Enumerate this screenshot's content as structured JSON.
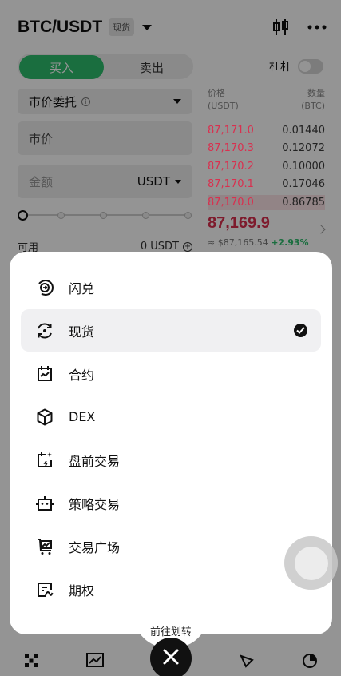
{
  "header": {
    "pair": "BTC/USDT",
    "badge": "现货"
  },
  "trade_tabs": {
    "buy": "买入",
    "sell": "卖出"
  },
  "leverage_label": "杠杆",
  "order_type": {
    "label": "市价委托",
    "info": "i"
  },
  "price_input": {
    "placeholder": "市价"
  },
  "amount_input": {
    "placeholder": "金额",
    "unit": "USDT"
  },
  "slider": {
    "value_percent": 0
  },
  "available": {
    "label": "可用",
    "value": "0 USDT"
  },
  "orderbook": {
    "price_header": "价格",
    "price_unit": "(USDT)",
    "qty_header": "数量",
    "qty_unit": "(BTC)",
    "asks": [
      {
        "price": "87,171.0",
        "qty": "0.01440",
        "depth": 0.0
      },
      {
        "price": "87,170.3",
        "qty": "0.12072",
        "depth": 0.0
      },
      {
        "price": "87,170.2",
        "qty": "0.10000",
        "depth": 0.0
      },
      {
        "price": "87,170.1",
        "qty": "0.17046",
        "depth": 0.0
      },
      {
        "price": "87,170.0",
        "qty": "0.86785",
        "depth": 1.0
      }
    ],
    "last_price": "87,169.9",
    "last_usd": "≈ $87,165.54",
    "change": "+2.93%"
  },
  "menu": {
    "items": [
      {
        "label": "闪兑",
        "icon": "swap-circle-icon",
        "selected": false
      },
      {
        "label": "现货",
        "icon": "spot-refresh-icon",
        "selected": true
      },
      {
        "label": "合约",
        "icon": "futures-calendar-icon",
        "selected": false
      },
      {
        "label": "DEX",
        "icon": "dex-cube-icon",
        "selected": false
      },
      {
        "label": "盘前交易",
        "icon": "premarket-icon",
        "selected": false
      },
      {
        "label": "策略交易",
        "icon": "bot-icon",
        "selected": false
      },
      {
        "label": "交易广场",
        "icon": "trading-square-icon",
        "selected": false
      },
      {
        "label": "期权",
        "icon": "options-icon",
        "selected": false
      }
    ]
  },
  "transfer_label": "前往划转",
  "colors": {
    "buy_green": "#2ebd6d",
    "sell_red": "#d9304f",
    "dim": "rgba(0,0,0,0.42)"
  }
}
